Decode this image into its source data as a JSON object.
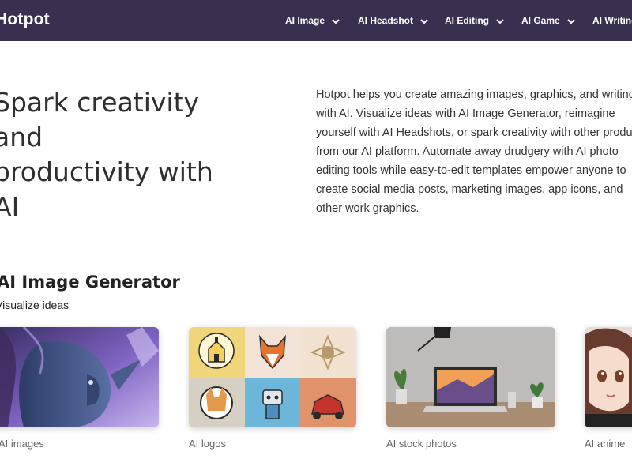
{
  "header": {
    "logo": "Hotpot",
    "nav": [
      {
        "label": "AI Image"
      },
      {
        "label": "AI Headshot"
      },
      {
        "label": "AI Editing"
      },
      {
        "label": "AI Game"
      },
      {
        "label": "AI Writing"
      }
    ],
    "bg_color": "#3b2f4f"
  },
  "hero": {
    "title_line1": "Spark creativity and",
    "title_line2": "productivity with AI",
    "description": "Hotpot helps you create amazing images, graphics, and writing with AI. Visualize ideas with AI Image Generator, reimagine yourself with AI Headshots, or spark creativity with other products from our AI platform. Automate away drudgery with AI photo editing tools while easy-to-edit templates empower anyone to create social media posts, marketing images, app icons, and other work graphics."
  },
  "section": {
    "title": "AI Image Generator",
    "subtitle": "Visualize ideas",
    "cards": [
      {
        "label": "AI images",
        "icon": "fantasy-elf-portrait-image"
      },
      {
        "label": "AI logos",
        "icon": "logo-grid-image"
      },
      {
        "label": "AI stock photos",
        "icon": "laptop-desk-photo"
      },
      {
        "label": "AI anime",
        "icon": "anime-girl-image"
      }
    ]
  }
}
